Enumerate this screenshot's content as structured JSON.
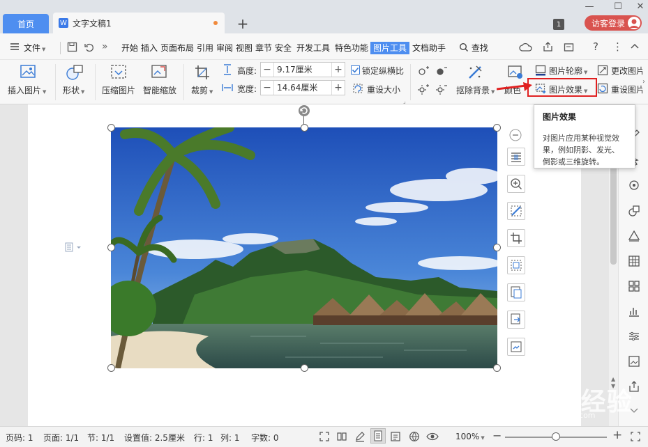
{
  "titlebar": {
    "home_tab": "首页",
    "doc_tab": "文字文稿1",
    "new_tab": "+",
    "window_count": "1",
    "login": "访客登录"
  },
  "menu": {
    "file": "文件",
    "items": [
      "开始",
      "插入",
      "页面布局",
      "引用",
      "审阅",
      "视图",
      "章节",
      "安全",
      "开发工具",
      "特色功能",
      "图片工具",
      "文档助手"
    ],
    "active": "图片工具",
    "search": "查找"
  },
  "ribbon": {
    "insert_picture": "插入图片",
    "shape": "形状",
    "compress": "压缩图片",
    "smart_scale": "智能缩放",
    "crop": "裁剪",
    "height_label": "高度:",
    "height_value": "9.17厘米",
    "width_label": "宽度:",
    "width_value": "14.64厘米",
    "lock_ratio": "锁定纵横比",
    "reset_size": "重设大小",
    "remove_bg": "抠除背景",
    "color": "颜色",
    "outline": "图片轮廓",
    "effects": "图片效果",
    "change_picture": "更改图片",
    "reset_picture": "重设图片"
  },
  "tooltip": {
    "title": "图片效果",
    "desc": "对图片应用某种视觉效果，例如阴影、发光、倒影或三维旋转。"
  },
  "status": {
    "page": "页码: 1",
    "pages": "页面: 1/1",
    "section": "节: 1/1",
    "setting": "设置值: 2.5厘米",
    "row": "行: 1",
    "col": "列: 1",
    "words": "字数: 0",
    "zoom": "100%"
  },
  "watermark": {
    "brand": "Baidu经验",
    "url": "jingyan.baidu.com"
  },
  "colors": {
    "accent": "#4e8ef0",
    "highlight": "#e02020",
    "login": "#d9534f"
  }
}
